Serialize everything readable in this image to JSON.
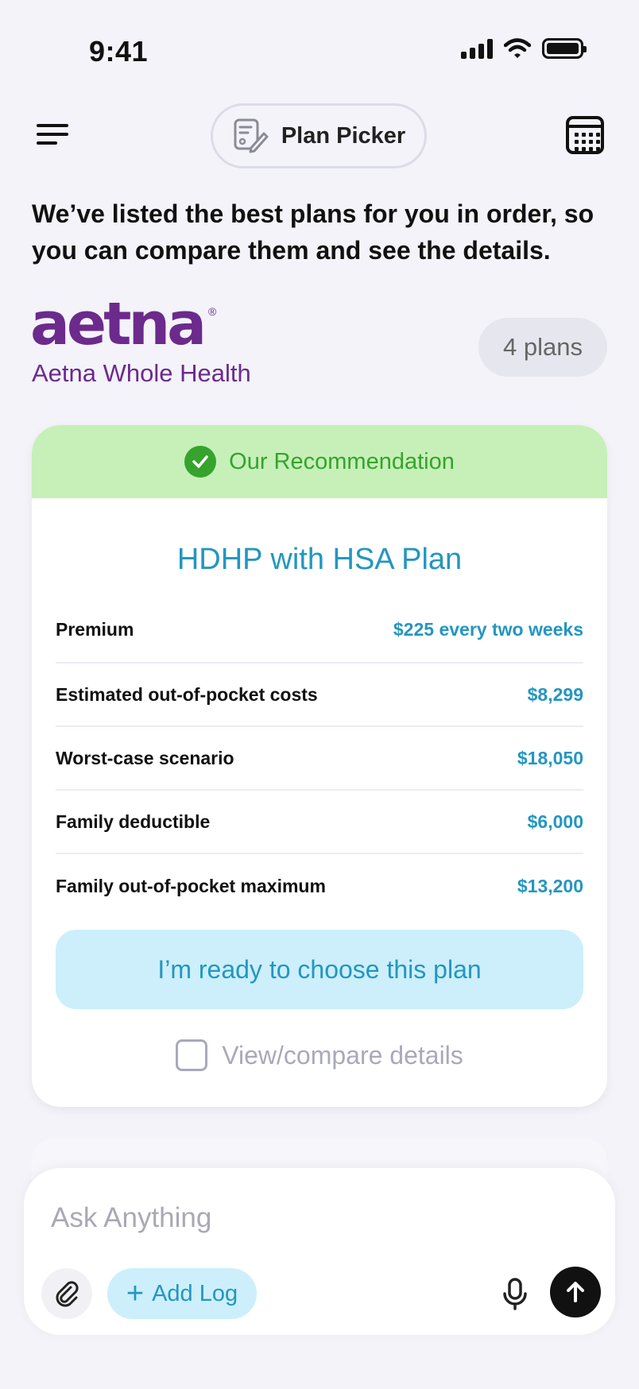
{
  "status_bar": {
    "time": "9:41"
  },
  "header": {
    "title": "Plan Picker"
  },
  "intro": "We’ve listed the best plans for you in order, so you can compare them and see the details.",
  "brand": {
    "logo_text": "aetna",
    "registered": "®",
    "subtitle": "Aetna Whole Health",
    "plans_count": "4 plans"
  },
  "recommendation": {
    "banner": "Our Recommendation",
    "plan_name": "HDHP with HSA Plan",
    "rows": [
      {
        "label": "Premium",
        "value": "$225 every two weeks"
      },
      {
        "label": "Estimated out-of-pocket costs",
        "value": "$8,299"
      },
      {
        "label": "Worst-case scenario",
        "value": "$18,050"
      },
      {
        "label": "Family deductible",
        "value": "$6,000"
      },
      {
        "label": "Family out-of-pocket maximum",
        "value": "$13,200"
      }
    ],
    "choose_button": "I’m ready to choose this plan",
    "compare_label": "View/compare details"
  },
  "composer": {
    "placeholder": "Ask Anything",
    "add_log": "Add Log"
  },
  "colors": {
    "brand_purple": "#6c2a8c",
    "accent_teal": "#2496c0",
    "success_green": "#36a32d",
    "recommend_bg": "#c6f0b8"
  },
  "icons": [
    "menu-icon",
    "plan-edit-icon",
    "calendar-icon",
    "check-circle-icon",
    "paperclip-icon",
    "plus-icon",
    "microphone-icon",
    "arrow-up-icon"
  ]
}
